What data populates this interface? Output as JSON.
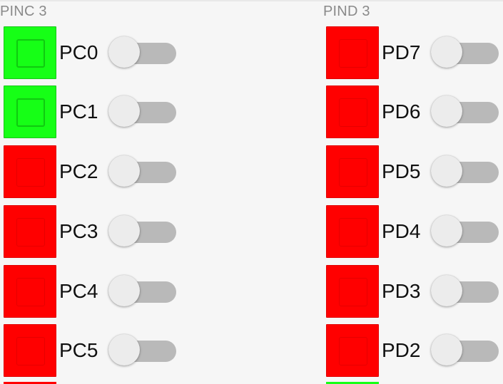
{
  "colors": {
    "led_on": "#16ff16",
    "led_off": "#ff0000",
    "switch_track": "#b9b9b9",
    "switch_thumb": "#ececec",
    "background": "#f6f6f6"
  },
  "port_c": {
    "title": "PINC 3",
    "pins": [
      {
        "label": "PC0",
        "led_state": "on",
        "switch_on": false
      },
      {
        "label": "PC1",
        "led_state": "on",
        "switch_on": false
      },
      {
        "label": "PC2",
        "led_state": "off",
        "switch_on": false
      },
      {
        "label": "PC3",
        "led_state": "off",
        "switch_on": false
      },
      {
        "label": "PC4",
        "led_state": "off",
        "switch_on": false
      },
      {
        "label": "PC5",
        "led_state": "off",
        "switch_on": false
      }
    ]
  },
  "port_d": {
    "title": "PIND 3",
    "pins": [
      {
        "label": "PD7",
        "led_state": "off",
        "switch_on": false
      },
      {
        "label": "PD6",
        "led_state": "off",
        "switch_on": false
      },
      {
        "label": "PD5",
        "led_state": "off",
        "switch_on": false
      },
      {
        "label": "PD4",
        "led_state": "off",
        "switch_on": false
      },
      {
        "label": "PD3",
        "led_state": "off",
        "switch_on": false
      },
      {
        "label": "PD2",
        "led_state": "off",
        "switch_on": false
      }
    ]
  }
}
